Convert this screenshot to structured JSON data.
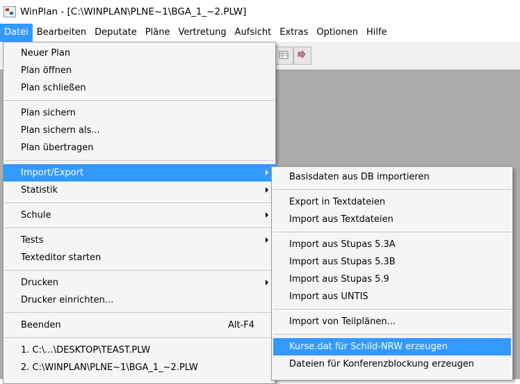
{
  "window": {
    "title": "WinPlan - [C:\\WINPLAN\\PLNE~1\\BGA_1_~2.PLW]",
    "icon": "winplan-app-icon"
  },
  "menubar": {
    "items": [
      "Datei",
      "Bearbeiten",
      "Deputate",
      "Pläne",
      "Vertretung",
      "Aufsicht",
      "Extras",
      "Optionen",
      "Hilfe"
    ],
    "active": "Datei",
    "highlight_color": "#3399ff"
  },
  "file_menu": {
    "neuer_plan": "Neuer Plan",
    "plan_oeffnen": "Plan öffnen",
    "plan_schliessen": "Plan schließen",
    "plan_sichern": "Plan sichern",
    "plan_sichern_als": "Plan sichern als...",
    "plan_uebertragen": "Plan übertragen",
    "import_export": "Import/Export",
    "statistik": "Statistik",
    "schule": "Schule",
    "tests": "Tests",
    "texteditor": "Texteditor starten",
    "drucken": "Drucken",
    "drucker_einrichten": "Drucker einrichten...",
    "beenden": "Beenden",
    "beenden_shortcut": "Alt-F4",
    "recent_1": "1. C:\\...\\DESKTOP\\TEAST.PLW",
    "recent_2": "2. C:\\WINPLAN\\PLNE~1\\BGA_1_~2.PLW"
  },
  "import_export_submenu": {
    "basisdaten": "Basisdaten aus DB importieren",
    "export_text": "Export in Textdateien",
    "import_text": "Import aus Textdateien",
    "stupas_53a": "Import aus Stupas 5.3A",
    "stupas_53b": "Import aus Stupas 5.3B",
    "stupas_59": "Import aus Stupas 5.9",
    "untis": "Import aus UNTIS",
    "teilplaene": "Import von Teilplänen...",
    "kurse_schild": "Kurse.dat für Schild-NRW erzeugen",
    "konferenz": "Dateien für Konferenzblockung erzeugen"
  }
}
